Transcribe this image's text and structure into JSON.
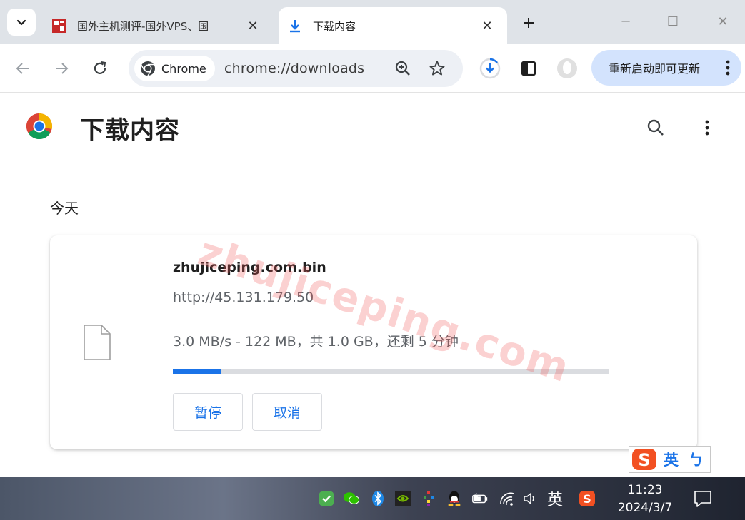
{
  "tabs": [
    {
      "title": "国外主机测评-国外VPS、国",
      "active": false,
      "favicon": "zhujiceping-favicon"
    },
    {
      "title": "下载内容",
      "active": true,
      "favicon": "download-icon"
    }
  ],
  "window_controls": {
    "minimize": "─",
    "maximize": "☐",
    "close": "✕"
  },
  "omnibox": {
    "chip_label": "Chrome",
    "url": "chrome://downloads"
  },
  "update_button": {
    "label": "重新启动即可更新"
  },
  "page": {
    "title": "下载内容",
    "date_group": "今天"
  },
  "download": {
    "file_name": "zhujiceping.com.bin",
    "source_url": "http://45.131.179.50",
    "status": "3.0 MB/s - 122 MB，共 1.0 GB，还剩 5 分钟",
    "progress_fraction": 0.11,
    "pause_label": "暂停",
    "cancel_label": "取消"
  },
  "watermark": "zhujiceping.com",
  "ime": {
    "mode": "英",
    "punct": "ㄅ"
  },
  "taskbar": {
    "language": "英",
    "time": "11:23",
    "date": "2024/3/7"
  },
  "colors": {
    "accent": "#1a73e8",
    "tabstrip": "#dfe3e8",
    "update_pill": "#d3e3fd"
  }
}
